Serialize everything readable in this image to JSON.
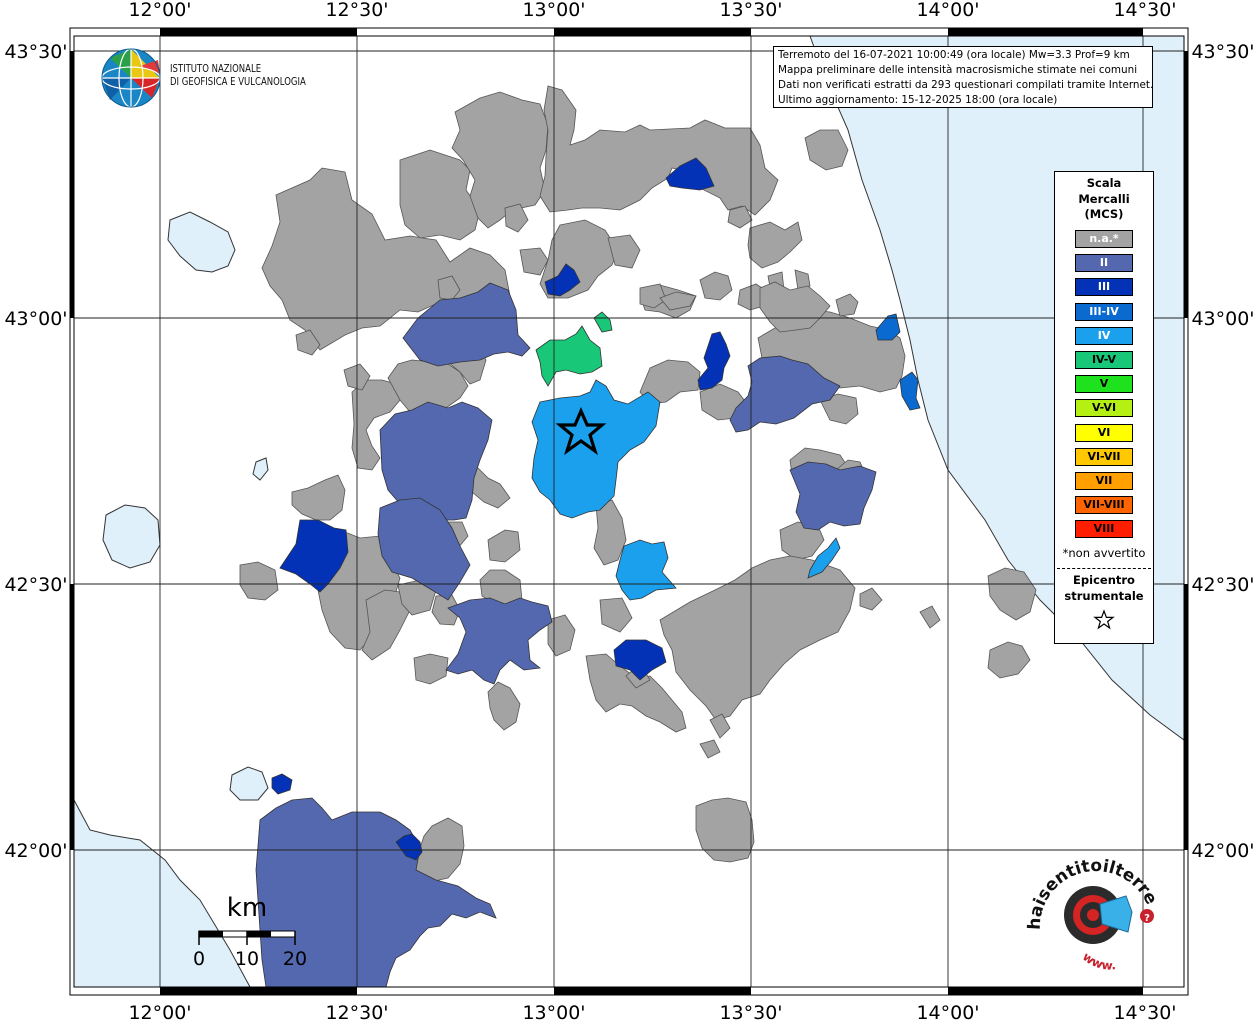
{
  "map": {
    "lon_labels": [
      "12°00'",
      "12°30'",
      "13°00'",
      "13°30'",
      "14°00'",
      "14°30'"
    ],
    "lat_labels": [
      "43°30'",
      "43°00'",
      "42°30'",
      "42°00'"
    ]
  },
  "info": {
    "line1": "Terremoto del 16-07-2021 10:00:49 (ora locale) Mw=3.3 Prof=9 km",
    "line2": "Mappa preliminare delle intensità macrosismiche stimate nei comuni",
    "line3": "Dati non verificati estratti da 293 questionari compilati tramite Internet.",
    "line4": "Ultimo aggiornamento: 15-12-2025 18:00 (ora locale)"
  },
  "ingv": {
    "line1": "ISTITUTO NAZIONALE",
    "line2": "DI GEOFISICA E VULCANOLOGIA"
  },
  "legend": {
    "title1": "Scala",
    "title2": "Mercalli",
    "title3": "(MCS)",
    "items": [
      {
        "label": "n.a.*",
        "color": "#a3a3a3"
      },
      {
        "label": "II",
        "color": "#5468b0"
      },
      {
        "label": "III",
        "color": "#0432b7"
      },
      {
        "label": "III-IV",
        "color": "#0a6ad0"
      },
      {
        "label": "IV",
        "color": "#1aa0ec"
      },
      {
        "label": "IV-V",
        "color": "#18c878"
      },
      {
        "label": "V",
        "color": "#1de21d"
      },
      {
        "label": "V-VI",
        "color": "#b4f014"
      },
      {
        "label": "VI",
        "color": "#ffff00"
      },
      {
        "label": "VI-VII",
        "color": "#ffc800"
      },
      {
        "label": "VII",
        "color": "#ffa000"
      },
      {
        "label": "VII-VIII",
        "color": "#ff6400"
      },
      {
        "label": "VIII",
        "color": "#ff1e00"
      }
    ],
    "note": "*non avvertito",
    "epi1": "Epicentro",
    "epi2": "strumentale"
  },
  "scalebar": {
    "unit": "km",
    "ticks": [
      "0",
      "10",
      "20"
    ]
  },
  "hsit": {
    "text": "haisentitoilterremoto.it",
    "url_text": "www."
  },
  "colors": {
    "sea": "#dff0fb",
    "na": "#a3a3a3",
    "II": "#5468b0",
    "III": "#0432b7",
    "III-IV": "#0a6ad0",
    "IV": "#1aa0ec",
    "IV-V": "#18c878"
  }
}
